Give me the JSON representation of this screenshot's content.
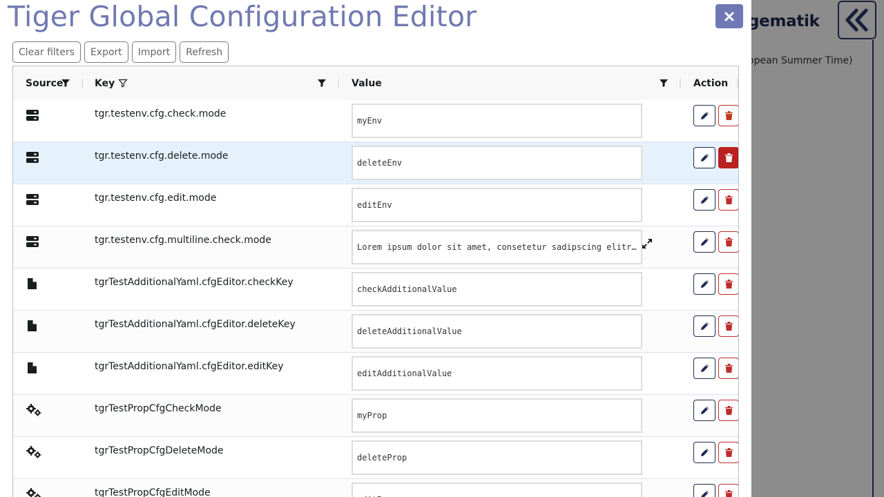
{
  "background": {
    "logo_text": "gematik",
    "timezone_text": "opean Summer Time)"
  },
  "modal": {
    "title": "Tiger Global Configuration Editor",
    "close_label": "×"
  },
  "toolbar": {
    "clear_filters": "Clear filters",
    "export": "Export",
    "import": "Import",
    "refresh": "Refresh"
  },
  "grid": {
    "columns": {
      "source": "Source",
      "key": "Key",
      "value": "Value",
      "action": "Action"
    },
    "rows": [
      {
        "source_icon": "server-icon",
        "key": "tgr.testenv.cfg.check.mode",
        "value": "myEnv"
      },
      {
        "source_icon": "server-icon",
        "key": "tgr.testenv.cfg.delete.mode",
        "value": "deleteEnv"
      },
      {
        "source_icon": "server-icon",
        "key": "tgr.testenv.cfg.edit.mode",
        "value": "editEnv"
      },
      {
        "source_icon": "server-icon",
        "key": "tgr.testenv.cfg.multiline.check.mode",
        "value": "Lorem ipsum dolor sit amet, consetetur sadipscing elitr, sed diam nonumy"
      },
      {
        "source_icon": "file-icon",
        "key": "tgrTestAdditionalYaml.cfgEditor.checkKey",
        "value": "checkAdditionalValue"
      },
      {
        "source_icon": "file-icon",
        "key": "tgrTestAdditionalYaml.cfgEditor.deleteKey",
        "value": "deleteAdditionalValue"
      },
      {
        "source_icon": "file-icon",
        "key": "tgrTestAdditionalYaml.cfgEditor.editKey",
        "value": "editAdditionalValue"
      },
      {
        "source_icon": "gears-icon",
        "key": "tgrTestPropCfgCheckMode",
        "value": "myProp"
      },
      {
        "source_icon": "gears-icon",
        "key": "tgrTestPropCfgDeleteMode",
        "value": "deleteProp"
      },
      {
        "source_icon": "gears-icon",
        "key": "tgrTestPropCfgEditMode",
        "value": "editProp"
      }
    ]
  },
  "colors": {
    "title": "#7079b0",
    "close_button": "#6f78b4",
    "edit_border": "#1f2b50",
    "delete": "#c02b2b",
    "row_hover": "#e6f2fb"
  }
}
